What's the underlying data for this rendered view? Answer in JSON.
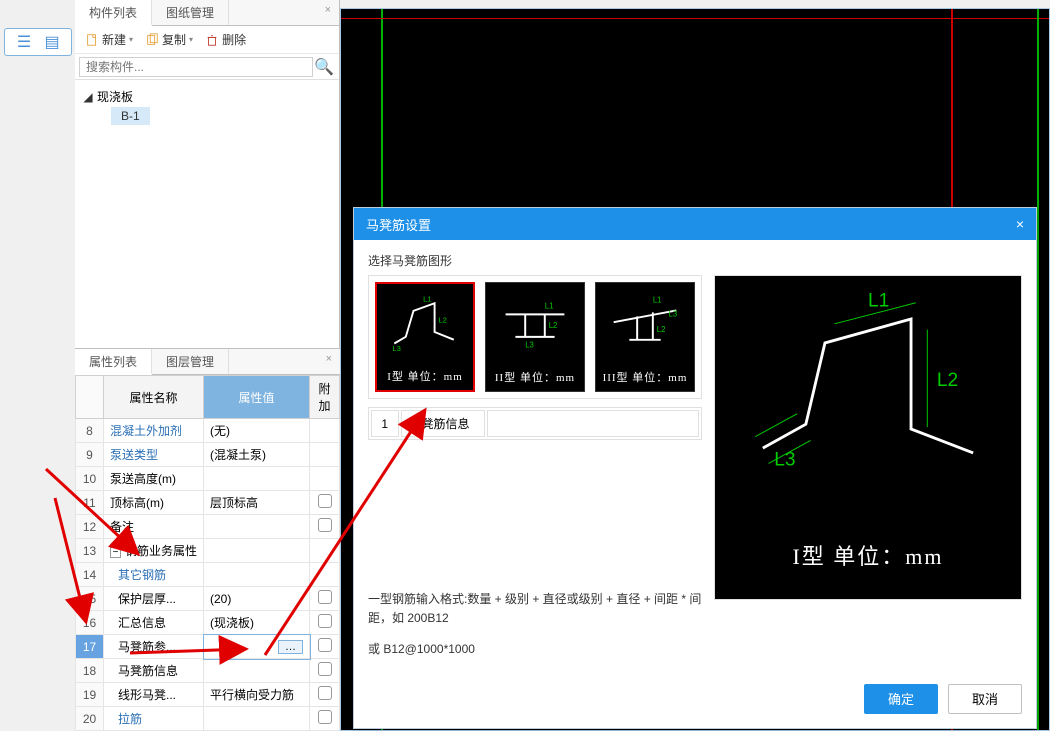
{
  "left_panel": {
    "tabs": {
      "components": "构件列表",
      "drawings": "图纸管理"
    },
    "toolbar": {
      "new": "新建",
      "copy": "复制",
      "delete": "删除"
    },
    "search_placeholder": "搜索构件...",
    "tree": {
      "root": "现浇板",
      "child": "B-1"
    }
  },
  "prop_panel": {
    "tabs": {
      "props": "属性列表",
      "layers": "图层管理"
    },
    "headers": {
      "name": "属性名称",
      "value": "属性值",
      "extra": "附加"
    },
    "rows": [
      {
        "n": "8",
        "name": "混凝土外加剂",
        "value": "(无)",
        "blue": true,
        "chk": false,
        "ind": 0
      },
      {
        "n": "9",
        "name": "泵送类型",
        "value": "(混凝土泵)",
        "blue": true,
        "chk": false,
        "ind": 0
      },
      {
        "n": "10",
        "name": "泵送高度(m)",
        "value": "",
        "blue": false,
        "chk": false,
        "ind": 0
      },
      {
        "n": "11",
        "name": "顶标高(m)",
        "value": "层顶标高",
        "blue": false,
        "chk": true,
        "ind": 0
      },
      {
        "n": "12",
        "name": "备注",
        "value": "",
        "blue": false,
        "chk": true,
        "ind": 0
      },
      {
        "n": "13",
        "name": "钢筋业务属性",
        "value": "",
        "blue": false,
        "chk": false,
        "ind": 0,
        "expander": true
      },
      {
        "n": "14",
        "name": "其它钢筋",
        "value": "",
        "blue": true,
        "chk": false,
        "ind": 1
      },
      {
        "n": "15",
        "name": "保护层厚...",
        "value": "(20)",
        "blue": false,
        "chk": true,
        "ind": 1
      },
      {
        "n": "16",
        "name": "汇总信息",
        "value": "(现浇板)",
        "blue": false,
        "chk": true,
        "ind": 1
      },
      {
        "n": "17",
        "name": "马凳筋参...",
        "value": "",
        "blue": false,
        "chk": true,
        "ind": 1,
        "hi": true,
        "btn": true
      },
      {
        "n": "18",
        "name": "马凳筋信息",
        "value": "",
        "blue": false,
        "chk": true,
        "ind": 1
      },
      {
        "n": "19",
        "name": "线形马凳...",
        "value": "平行横向受力筋",
        "blue": false,
        "chk": true,
        "ind": 1
      },
      {
        "n": "20",
        "name": "拉筋",
        "value": "",
        "blue": true,
        "chk": true,
        "ind": 1
      }
    ]
  },
  "modal": {
    "title": "马凳筋设置",
    "select_label": "选择马凳筋图形",
    "thumbs": [
      {
        "caption": "I型 单位：mm",
        "selected": true
      },
      {
        "caption": "II型 单位：mm",
        "selected": false
      },
      {
        "caption": "III型 单位：mm",
        "selected": false
      }
    ],
    "preview_caption": "I型 单位：mm",
    "labels": {
      "L1": "L1",
      "L2": "L2",
      "L3": "L3"
    },
    "info_cell_num": "1",
    "info_cell_label": "马凳筋信息",
    "hint1": "一型钢筋输入格式:数量 + 级别 + 直径或级别 + 直径 + 间距 * 间距，如 200B12",
    "hint2": "或 B12@1000*1000",
    "ok": "确定",
    "cancel": "取消"
  }
}
